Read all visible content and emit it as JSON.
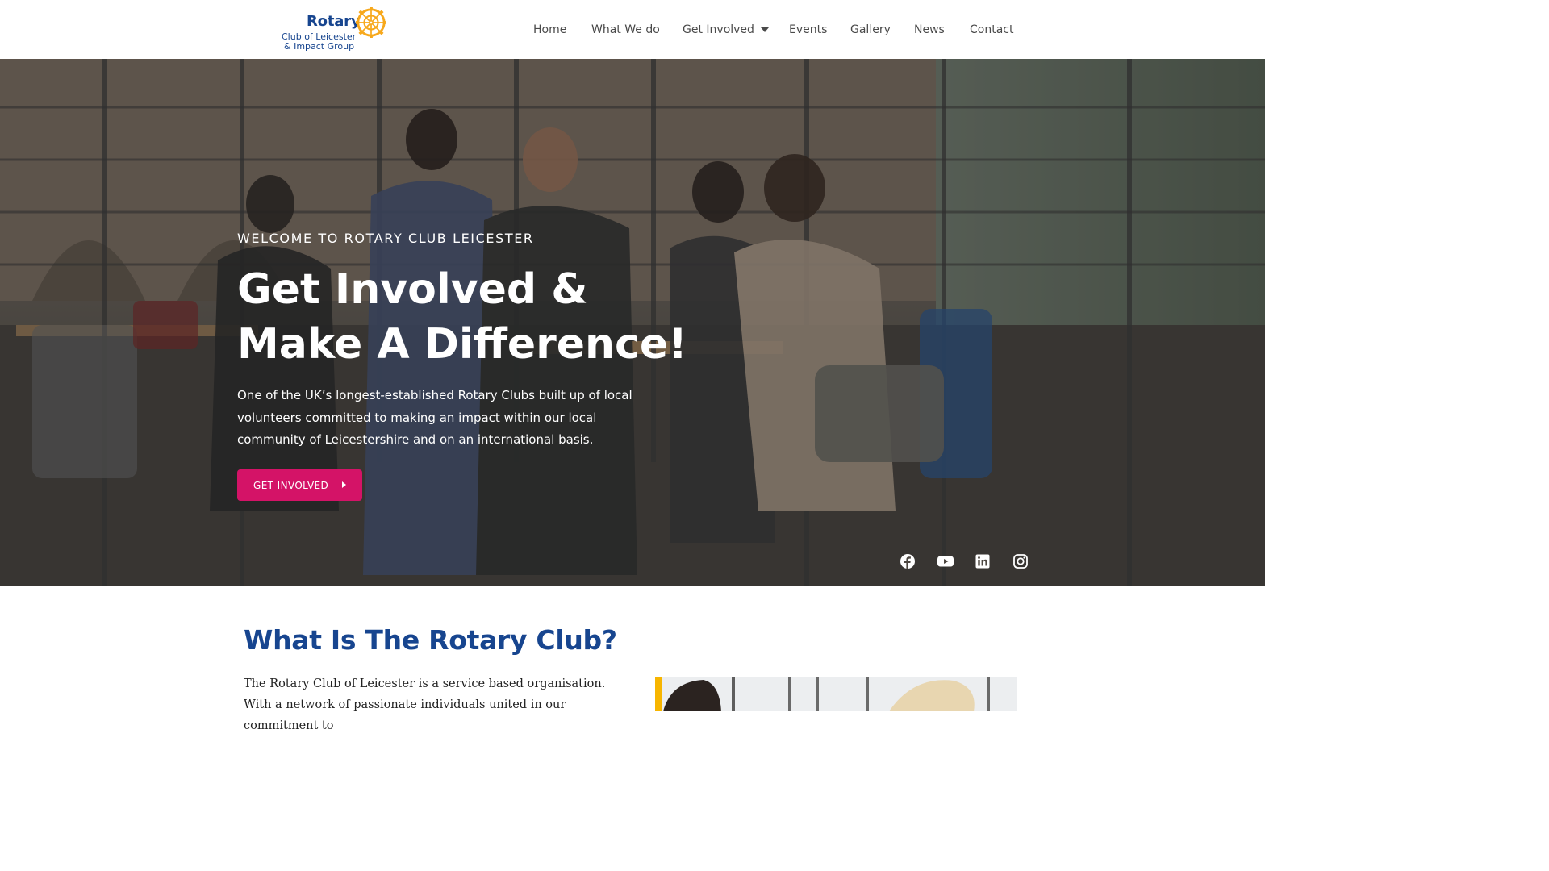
{
  "header": {
    "logo": {
      "wordmark": "Rotary",
      "subtitle_line1": "Club of Leicester",
      "subtitle_line2": "& Impact Group"
    },
    "nav": [
      {
        "label": "Home",
        "has_dropdown": false
      },
      {
        "label": "What We do",
        "has_dropdown": false
      },
      {
        "label": "Get Involved",
        "has_dropdown": true
      },
      {
        "label": "Events",
        "has_dropdown": false
      },
      {
        "label": "Gallery",
        "has_dropdown": false
      },
      {
        "label": "News",
        "has_dropdown": false
      },
      {
        "label": "Contact",
        "has_dropdown": false
      }
    ]
  },
  "hero": {
    "kicker": "WELCOME TO ROTARY CLUB LEICESTER",
    "headline_line1": "Get Involved &",
    "headline_line2": "Make A Difference!",
    "lead": "One of the UK’s longest-established Rotary Clubs built up of local volunteers committed to making an impact within our local community of Leicestershire and on an international basis.",
    "cta_label": "GET INVOLVED",
    "social": [
      "facebook-icon",
      "youtube-icon",
      "linkedin-icon",
      "instagram-icon"
    ]
  },
  "about": {
    "title": "What Is The Rotary Club?",
    "body": "The Rotary Club of Leicester is a service based organisation. With a network of passionate individuals united in our commitment to"
  },
  "colors": {
    "brand_blue": "#17458f",
    "rotary_gold": "#f7a81b",
    "cta_pink": "#d41367",
    "nav_text": "#4a4a4a"
  }
}
